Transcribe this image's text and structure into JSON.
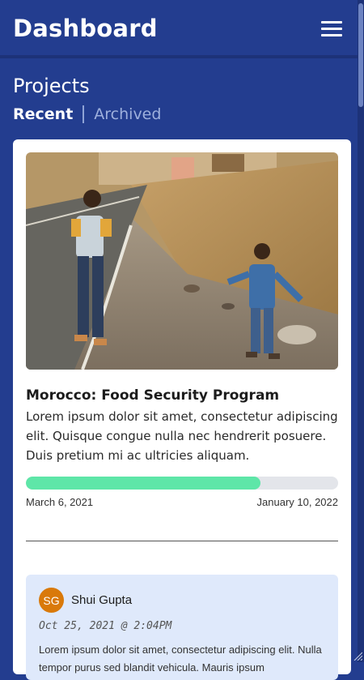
{
  "header": {
    "title": "Dashboard",
    "menu_icon": "hamburger-menu-icon"
  },
  "projects": {
    "section_title": "Projects",
    "tabs": [
      {
        "label": "Recent",
        "active": true
      },
      {
        "label": "Archived",
        "active": false
      }
    ]
  },
  "project_card": {
    "title": "Morocco: Food Security Program",
    "description": "Lorem ipsum dolor sit amet, consectetur adipiscing elit. Quisque congue nulla nec hendrerit posuere. Duis pretium mi ac ultricies aliquam.",
    "progress_fraction": 0.75,
    "start_date": "March 6, 2021",
    "end_date": "January 10, 2022",
    "colors": {
      "progress_fill": "#5ee6a8",
      "progress_track": "#e3e5ea"
    }
  },
  "update": {
    "avatar_initials": "SG",
    "author": "Shui Gupta",
    "timestamp": "Oct 25, 2021 @ 2:04PM",
    "text": "Lorem ipsum dolor sit amet, consectetur adipiscing elit. Nulla tempor purus sed blandit vehicula. Mauris ipsum",
    "avatar_color": "#d9790a"
  },
  "theme": {
    "background": "#233d8f",
    "card": "#ffffff",
    "update_bg": "#dfe9fb"
  }
}
